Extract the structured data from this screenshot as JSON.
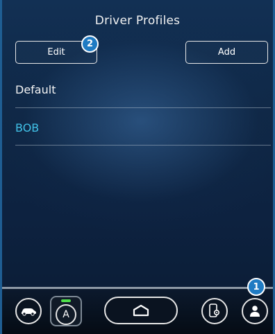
{
  "header": {
    "title": "Driver Profiles"
  },
  "toolbar": {
    "edit_label": "Edit",
    "add_label": "Add"
  },
  "callouts": {
    "edit_badge": "2",
    "profile_badge": "1"
  },
  "profiles": [
    {
      "name": "Default",
      "selected": false
    },
    {
      "name": "BOB",
      "selected": true
    }
  ],
  "bottom_bar": {
    "icons": [
      "car-icon",
      "auto-icon",
      "home-icon",
      "phone-settings-icon",
      "profile-icon"
    ],
    "auto_label": "A"
  },
  "colors": {
    "accent": "#41c2e8",
    "badge": "#1f7bc3",
    "indicator": "#4fe04a"
  }
}
